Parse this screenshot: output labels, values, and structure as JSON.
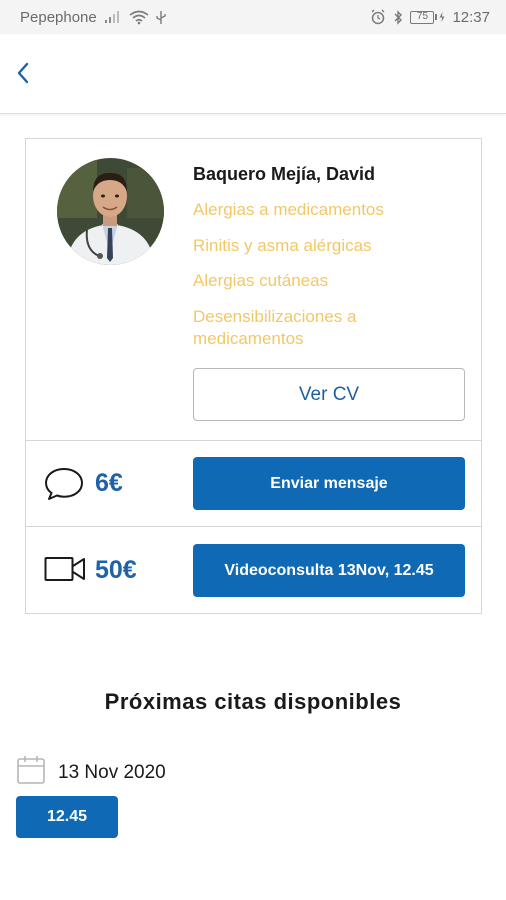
{
  "status_bar": {
    "carrier": "Pepephone",
    "battery": "75",
    "time": "12:37"
  },
  "doctor": {
    "name": "Baquero Mejía, David",
    "specialties": [
      "Alergias a medicamentos",
      "Rinitis y asma alérgicas",
      "Alergias cutáneas",
      "Desensibilizaciones a medicamentos"
    ],
    "cv_button": "Ver CV"
  },
  "services": {
    "message": {
      "price": "6€",
      "button": "Enviar mensaje",
      "icon": "chat-bubble-icon"
    },
    "video": {
      "price": "50€",
      "button": "Videoconsulta 13Nov, 12.45",
      "icon": "video-camera-icon"
    }
  },
  "appointments": {
    "title": "Próximas citas disponibles",
    "date": "13 Nov 2020",
    "slots": [
      "12.45"
    ]
  },
  "colors": {
    "primary": "#0f69b4",
    "price": "#1e63a8",
    "specialty": "#f2c866"
  }
}
